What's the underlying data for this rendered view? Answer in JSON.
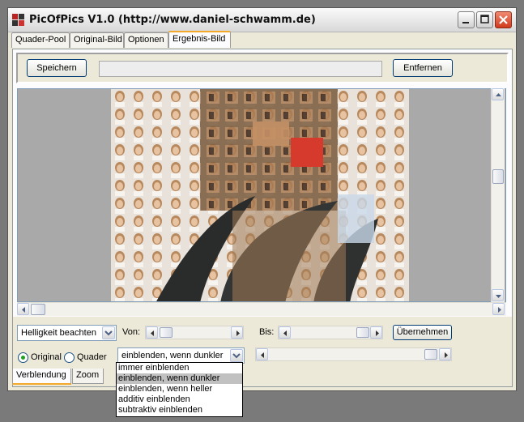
{
  "window": {
    "title": "PicOfPics V1.0 (http://www.daniel-schwamm.de)"
  },
  "tabs": [
    {
      "label": "Quader-Pool",
      "active": false
    },
    {
      "label": "Original-Bild",
      "active": false
    },
    {
      "label": "Optionen",
      "active": false
    },
    {
      "label": "Ergebnis-Bild",
      "active": true
    }
  ],
  "toolbar": {
    "save_label": "Speichern",
    "remove_label": "Entfernen"
  },
  "controls": {
    "mode_select": "Helligkeit beachten",
    "von_label": "Von:",
    "bis_label": "Bis:",
    "apply_label": "Übernehmen",
    "radio_original": "Original",
    "radio_quader": "Quader",
    "radio_selected": "Original",
    "blend_select": "einblenden, wenn dunkler"
  },
  "blend_options": [
    "immer einblenden",
    "einblenden, wenn dunkler",
    "einblenden, wenn heller",
    "additiv einblenden",
    "subtraktiv einblenden"
  ],
  "blend_selected_index": 1,
  "bottom_tabs": [
    {
      "label": "Verblendung",
      "active": true
    },
    {
      "label": "Zoom",
      "active": false
    }
  ],
  "colors": {
    "accent_tab": "#f4a92b",
    "close_button": "#d0391e",
    "selection": "#c1c1c1"
  }
}
